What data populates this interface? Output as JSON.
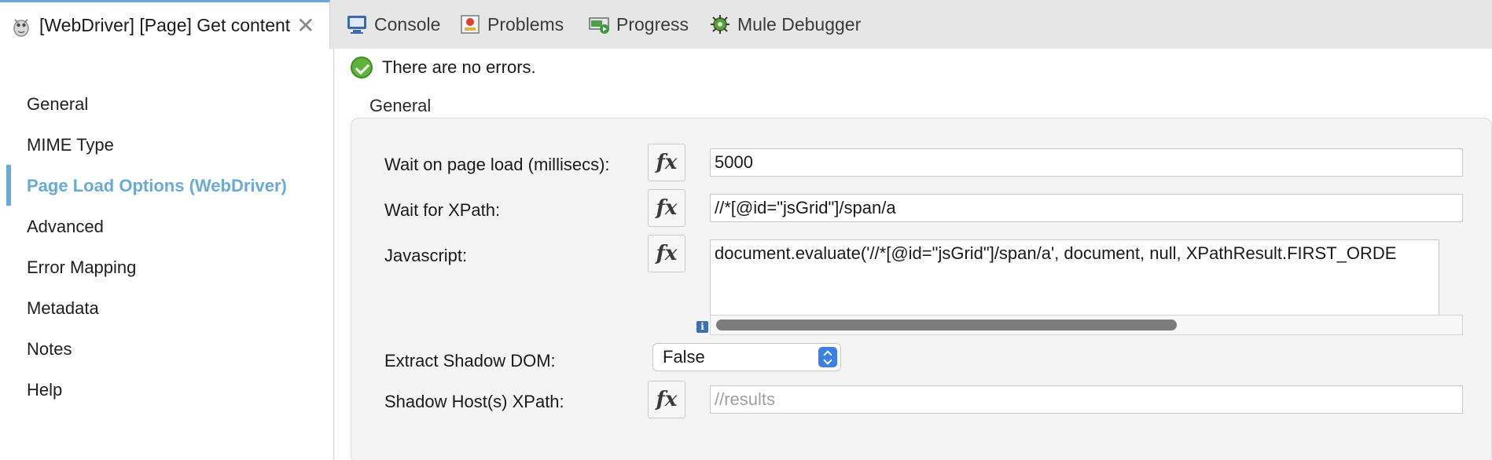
{
  "editor_tab": {
    "title": "[WebDriver] [Page] Get content",
    "icon": "mule-component-icon",
    "close_glyph": "✕"
  },
  "view_tabs": [
    {
      "label": "Console",
      "icon": "console-icon"
    },
    {
      "label": "Problems",
      "icon": "problems-icon"
    },
    {
      "label": "Progress",
      "icon": "progress-icon"
    },
    {
      "label": "Mule Debugger",
      "icon": "debugger-icon"
    }
  ],
  "sidebar": {
    "items": [
      {
        "label": "General"
      },
      {
        "label": "MIME Type"
      },
      {
        "label": "Page Load Options (WebDriver)",
        "active": true
      },
      {
        "label": "Advanced"
      },
      {
        "label": "Error Mapping"
      },
      {
        "label": "Metadata"
      },
      {
        "label": "Notes"
      },
      {
        "label": "Help"
      }
    ],
    "active_color": "#6aaad8"
  },
  "status": {
    "text": "There are no errors.",
    "icon": "check-circle-icon",
    "color": "#5db33b"
  },
  "group": {
    "title": "General"
  },
  "form": {
    "wait_page_load": {
      "label": "Wait on page load (millisecs):",
      "value": "5000"
    },
    "wait_xpath": {
      "label": "Wait for XPath:",
      "value": "//*[@id=\"jsGrid\"]/span/a"
    },
    "javascript": {
      "label": "Javascript:",
      "value": "document.evaluate('//*[@id=\"jsGrid\"]/span/a', document, null, XPathResult.FIRST_ORDE"
    },
    "extract_shadow": {
      "label": "Extract Shadow DOM:",
      "value": "False"
    },
    "shadow_host": {
      "label": "Shadow Host(s) XPath:",
      "placeholder": "//results"
    },
    "fx_label": "fx",
    "info_glyph": "i"
  }
}
